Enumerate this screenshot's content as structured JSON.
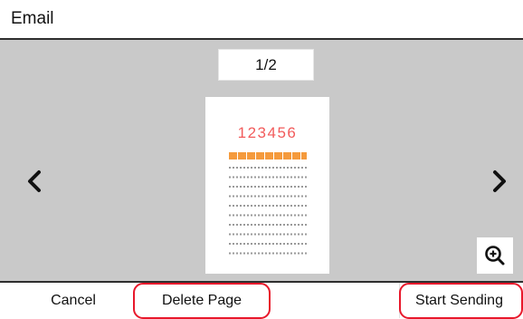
{
  "header": {
    "title": "Email"
  },
  "preview": {
    "page_indicator": "1/2",
    "document": {
      "number": "123456"
    }
  },
  "icons": {
    "prev": "chevron-left-icon",
    "next": "chevron-right-icon",
    "zoom": "zoom-in-icon"
  },
  "footer": {
    "cancel_label": "Cancel",
    "delete_label": "Delete Page",
    "start_label": "Start Sending"
  },
  "colors": {
    "preview_background": "#c9c9c9",
    "document_number": "#f25b5b",
    "document_bar": "#f59a3c",
    "highlight": "#e8182b"
  }
}
